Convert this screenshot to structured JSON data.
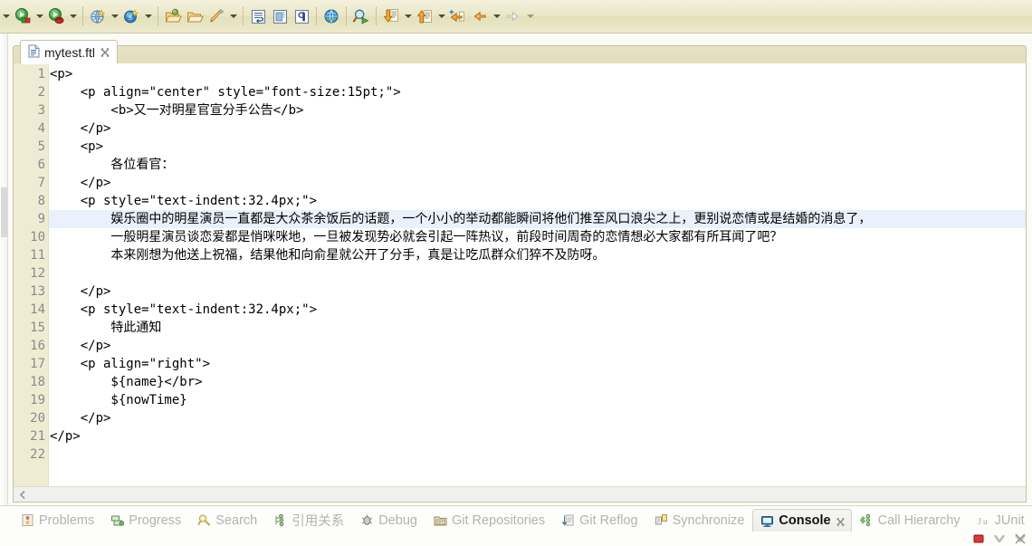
{
  "toolbar": {
    "groups": [
      {
        "name": "run-group",
        "buttons": [
          {
            "icon": "run-icon",
            "label": "Run",
            "has_dropdown": true
          },
          {
            "icon": "debug-icon",
            "label": "Debug",
            "has_dropdown": true
          }
        ]
      },
      {
        "name": "server-group",
        "buttons": [
          {
            "icon": "new-server-icon",
            "label": "New Server",
            "has_dropdown": true
          },
          {
            "icon": "svn-icon",
            "label": "SVN",
            "has_dropdown": true
          }
        ]
      },
      {
        "name": "package-group",
        "buttons": [
          {
            "icon": "export-package-icon",
            "label": "Export",
            "has_dropdown": false
          },
          {
            "icon": "open-package-icon",
            "label": "Open Package",
            "has_dropdown": false
          },
          {
            "icon": "build-icon",
            "label": "Build",
            "has_dropdown": true
          }
        ]
      },
      {
        "name": "editor-group",
        "buttons": [
          {
            "icon": "word-wrap-icon",
            "label": "Toggle Word Wrap",
            "has_dropdown": false
          },
          {
            "icon": "block-selection-icon",
            "label": "Toggle Block Selection",
            "has_dropdown": false
          },
          {
            "icon": "whitespace-icon",
            "label": "Show Whitespace Characters",
            "has_dropdown": false
          }
        ]
      },
      {
        "name": "browser-group",
        "buttons": [
          {
            "icon": "web-browser-icon",
            "label": "Open Web Browser",
            "has_dropdown": false
          }
        ]
      },
      {
        "name": "search-group",
        "buttons": [
          {
            "icon": "search-run-icon",
            "label": "Search",
            "has_dropdown": false
          }
        ]
      },
      {
        "name": "nav-group",
        "buttons": [
          {
            "icon": "next-annotation-icon",
            "label": "Next Annotation",
            "has_dropdown": true
          },
          {
            "icon": "previous-annotation-icon",
            "label": "Previous Annotation",
            "has_dropdown": true
          }
        ]
      },
      {
        "name": "history-group",
        "buttons": [
          {
            "icon": "last-edit-location-icon",
            "label": "Last Edit Location",
            "has_dropdown": false
          },
          {
            "icon": "back-icon",
            "label": "Back",
            "has_dropdown": true
          },
          {
            "icon": "forward-icon",
            "label": "Forward",
            "has_dropdown": true,
            "disabled": true
          }
        ]
      }
    ]
  },
  "editor": {
    "tab": {
      "label": "mytest.ftl",
      "icon": "file-icon",
      "close_icon": "close-icon"
    },
    "current_line": 9,
    "lines": [
      {
        "n": "1",
        "text": "<p>"
      },
      {
        "n": "2",
        "text": "    <p align=\"center\" style=\"font-size:15pt;\">"
      },
      {
        "n": "3",
        "text": "        <b>又一对明星官宣分手公告</b>"
      },
      {
        "n": "4",
        "text": "    </p>"
      },
      {
        "n": "5",
        "text": "    <p>"
      },
      {
        "n": "6",
        "text": "        各位看官："
      },
      {
        "n": "7",
        "text": "    </p>"
      },
      {
        "n": "8",
        "text": "    <p style=\"text-indent:32.4px;\">"
      },
      {
        "n": "9",
        "text": "        娱乐圈中的明星演员一直都是大众茶余饭后的话题，一个小小的举动都能瞬间将他们推至风口浪尖之上，更别说恋情或是结婚的消息了，"
      },
      {
        "n": "10",
        "text": "        一般明星演员谈恋爱都是悄咪咪地，一旦被发现势必就会引起一阵热议，前段时间周奇的恋情想必大家都有所耳闻了吧？"
      },
      {
        "n": "11",
        "text": "        本来刚想为他送上祝福，结果他和向俞星就公开了分手，真是让吃瓜群众们猝不及防呀。"
      },
      {
        "n": "12",
        "text": ""
      },
      {
        "n": "13",
        "text": "    </p>"
      },
      {
        "n": "14",
        "text": "    <p style=\"text-indent:32.4px;\">"
      },
      {
        "n": "15",
        "text": "        特此通知"
      },
      {
        "n": "16",
        "text": "    </p>"
      },
      {
        "n": "17",
        "text": "    <p align=\"right\">"
      },
      {
        "n": "18",
        "text": "        ${name}</br>"
      },
      {
        "n": "19",
        "text": "        ${nowTime}"
      },
      {
        "n": "20",
        "text": "    </p>"
      },
      {
        "n": "21",
        "text": "</p>"
      },
      {
        "n": "22",
        "text": ""
      }
    ],
    "hscroll": {
      "left_arrow_icon": "chevron-left-icon"
    }
  },
  "view_tabs": [
    {
      "label": "Problems",
      "icon": "problems-icon",
      "active": false
    },
    {
      "label": "Progress",
      "icon": "progress-icon",
      "active": false
    },
    {
      "label": "Search",
      "icon": "search-icon",
      "active": false
    },
    {
      "label": "引用关系",
      "icon": "call-reference-icon",
      "active": false
    },
    {
      "label": "Debug",
      "icon": "debug-bug-icon",
      "active": false
    },
    {
      "label": "Git Repositories",
      "icon": "git-repo-icon",
      "active": false
    },
    {
      "label": "Git Reflog",
      "icon": "git-reflog-icon",
      "active": false
    },
    {
      "label": "Synchronize",
      "icon": "synchronize-icon",
      "active": false
    },
    {
      "label": "Console",
      "icon": "console-icon",
      "active": true,
      "close_icon": "close-icon"
    },
    {
      "label": "Call Hierarchy",
      "icon": "call-hierarchy-icon",
      "active": false
    },
    {
      "label": "JUnit",
      "icon": "junit-icon",
      "active": false
    }
  ],
  "console_tools": [
    {
      "icon": "terminate-icon",
      "label": "Terminate"
    },
    {
      "icon": "remove-launch-icon",
      "label": "Remove All Terminated Launches"
    },
    {
      "icon": "clear-console-icon",
      "label": "Clear Console"
    }
  ],
  "colors": {
    "toolbar_bg": "#eae7c6",
    "tab_bar_bg": "#e2dfbc",
    "gutter_bg": "#efecd4",
    "current_line_highlight": "#e8f1fc",
    "active_tab_bg": "#ffffff",
    "code_text": "#000000",
    "line_number": "#8a8a8a",
    "inactive_view_tab": "#b2b2b2",
    "border": "#c6c3a2"
  }
}
